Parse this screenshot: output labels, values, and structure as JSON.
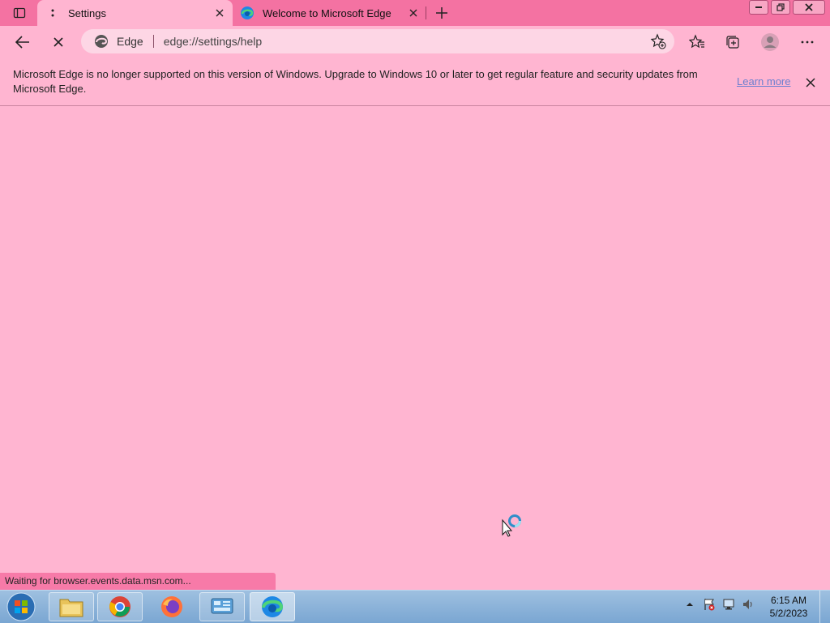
{
  "browser": {
    "tabs": [
      {
        "title": "Settings",
        "favicon": "loading-dots-icon",
        "active": true
      },
      {
        "title": "Welcome to Microsoft Edge",
        "favicon": "edge-logo-icon",
        "active": false
      }
    ],
    "address": {
      "site_label": "Edge",
      "url": "edge://settings/help"
    }
  },
  "infobar": {
    "message": "Microsoft Edge is no longer supported on this version of Windows. Upgrade to Windows 10 or later to get regular feature and security updates from Microsoft Edge.",
    "link": "Learn more"
  },
  "status": {
    "text": "Waiting for browser.events.data.msn.com..."
  },
  "taskbar": {
    "apps": [
      "file-explorer",
      "google-chrome",
      "firefox",
      "control-panel",
      "microsoft-edge"
    ],
    "clock": {
      "time": "6:15 AM",
      "date": "5/2/2023"
    }
  },
  "colors": {
    "accent": "#f472a2",
    "page_bg": "#ffb5d1",
    "link": "#6b7fd0"
  }
}
